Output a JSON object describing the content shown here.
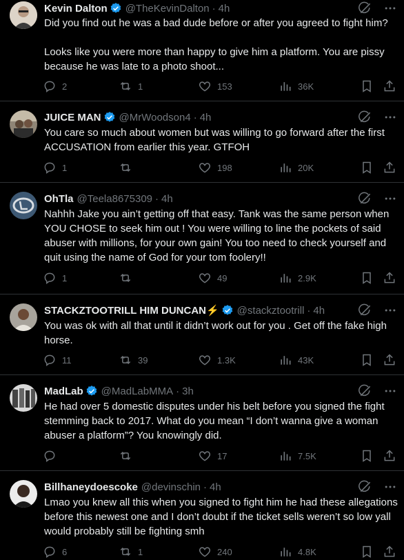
{
  "tweets": [
    {
      "name": "Kevin Dalton",
      "handle": "@TheKevinDalton",
      "time": "4h",
      "text": "Did you find out he was a bad dude before or after you agreed to fight him?\n\nLooks like you were more than happy to give him a platform. You are pissy because he was late to a photo shoot...",
      "replies": "2",
      "reposts": "1",
      "likes": "153",
      "views": "36K"
    },
    {
      "name": "JUICE MAN",
      "handle": "@MrWoodson4",
      "time": "4h",
      "text": "You care so much about women but was willing to go forward after the first ACCUSATION from earlier this year. GTFOH",
      "replies": "1",
      "reposts": "",
      "likes": "198",
      "views": "20K"
    },
    {
      "name": "OhTla",
      "handle": "@Teela8675309",
      "time": "4h",
      "text": "Nahhh Jake you ain’t getting off that easy. Tank was the same person when YOU CHOSE to seek him out ! You were willing to line the pockets of said abuser with millions, for your own gain! You too need to check yourself and quit using the name of God for your tom foolery!!",
      "replies": "1",
      "reposts": "",
      "likes": "49",
      "views": "2.9K"
    },
    {
      "name": "STACKZTOOTRILL HIM DUNCAN⚡",
      "handle": "@stackztootrill",
      "time": "4h",
      "text": "You was ok with all that until it didn’t work out for you . Get off the fake high horse.",
      "replies": "11",
      "reposts": "39",
      "likes": "1.3K",
      "views": "43K"
    },
    {
      "name": "MadLab",
      "handle": "@MadLabMMA",
      "time": "3h",
      "text": "He had over 5 domestic disputes under his belt before you signed the fight stemming back to 2017. What do you mean “I don’t wanna give a woman abuser a platform”? You knowingly did.",
      "replies": "",
      "reposts": "",
      "likes": "17",
      "views": "7.5K"
    },
    {
      "name": "Billhaneydoescoke",
      "handle": "@devinschin",
      "time": "4h",
      "text": "Lmao you knew all this when you signed to fight him he had these allegations before this newest one and I don’t doubt if the ticket sells weren’t so low yall would probably still be fighting smh",
      "replies": "6",
      "reposts": "1",
      "likes": "240",
      "views": "4.8K"
    }
  ],
  "colors": {
    "accent_blue": "#1d9bf0",
    "muted": "#71767b",
    "text": "#e7e9ea",
    "border": "#2f3336"
  },
  "icons": [
    "grok-icon",
    "more-icon",
    "reply-icon",
    "repost-icon",
    "like-icon",
    "views-icon",
    "bookmark-icon",
    "share-icon",
    "verified-icon"
  ]
}
